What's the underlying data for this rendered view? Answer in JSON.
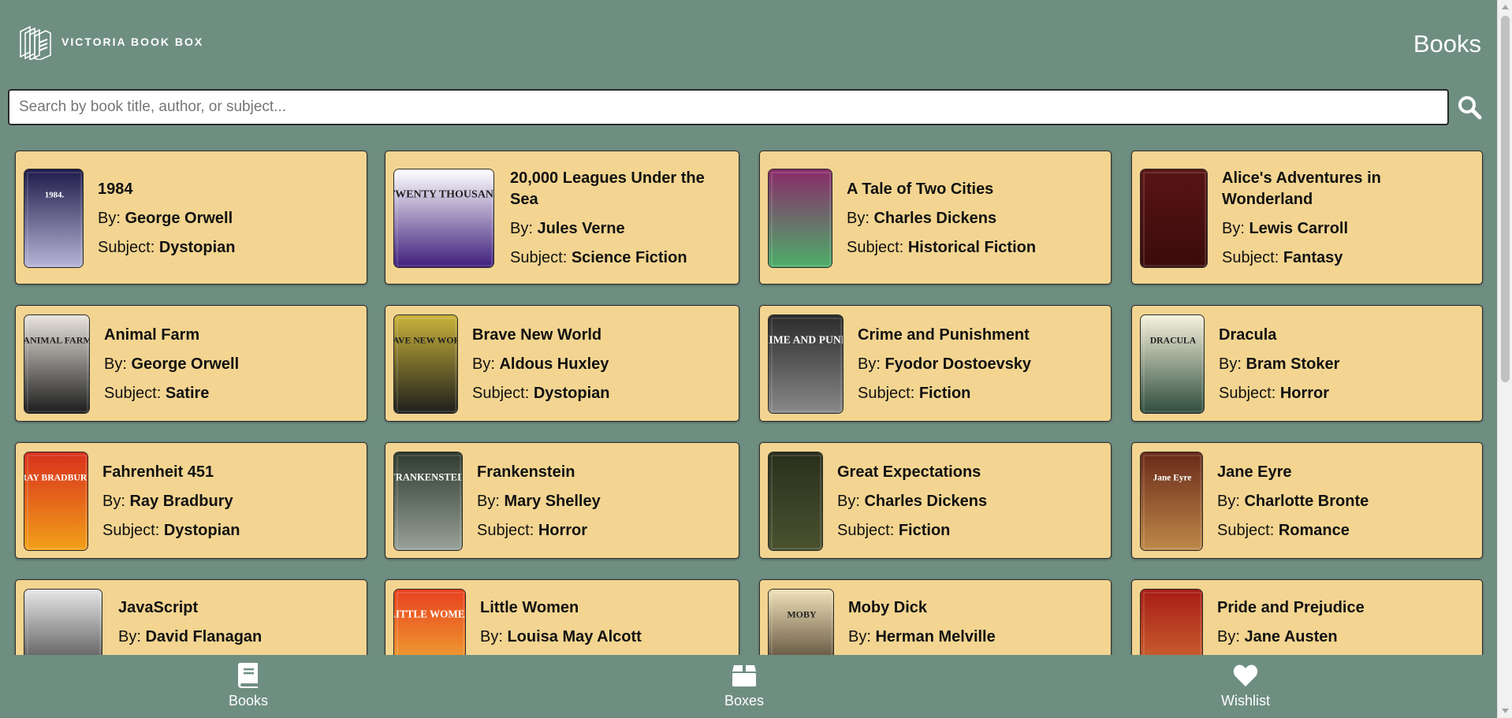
{
  "header": {
    "brand": "VICTORIA BOOK BOX",
    "page_title": "Books"
  },
  "search": {
    "placeholder": "Search by book title, author, or subject...",
    "value": "",
    "icon": "search-icon"
  },
  "labels": {
    "by": "By: ",
    "subject": "Subject: "
  },
  "books": [
    {
      "title": "1984",
      "author": "George Orwell",
      "subject": "Dystopian",
      "cover_colors": [
        "#1f1a4a",
        "#b8b8d8"
      ],
      "cover_text": "1984."
    },
    {
      "title": "20,000 Leagues Under the Sea",
      "author": "Jules Verne",
      "subject": "Science Fiction",
      "cover_colors": [
        "#ffffff",
        "#3b1a7a"
      ],
      "cover_text": "TWENTY THOUSAND LEAGUES UNDER THE SEA"
    },
    {
      "title": "A Tale of Two Cities",
      "author": "Charles Dickens",
      "subject": "Historical Fiction",
      "cover_colors": [
        "#8a2b6a",
        "#4bb06a"
      ],
      "cover_text": ""
    },
    {
      "title": "Alice's Adventures in Wonderland",
      "author": "Lewis Carroll",
      "subject": "Fantasy",
      "cover_colors": [
        "#5a1414",
        "#3a0b0b"
      ],
      "cover_text": ""
    },
    {
      "title": "Animal Farm",
      "author": "George Orwell",
      "subject": "Satire",
      "cover_colors": [
        "#e8e4dc",
        "#1a1a1a"
      ],
      "cover_text": "ANIMAL FARM"
    },
    {
      "title": "Brave New World",
      "author": "Aldous Huxley",
      "subject": "Dystopian",
      "cover_colors": [
        "#c9b23a",
        "#1c1c1c"
      ],
      "cover_text": "BRAVE NEW WORLD"
    },
    {
      "title": "Crime and Punishment",
      "author": "Fyodor Dostoevsky",
      "subject": "Fiction",
      "cover_colors": [
        "#2b2b2b",
        "#8a8a8a"
      ],
      "cover_text": "CRIME AND PUNISHMENT"
    },
    {
      "title": "Dracula",
      "author": "Bram Stoker",
      "subject": "Horror",
      "cover_colors": [
        "#f6f2dc",
        "#2c4a3a"
      ],
      "cover_text": "DRACULA"
    },
    {
      "title": "Fahrenheit 451",
      "author": "Ray Bradbury",
      "subject": "Dystopian",
      "cover_colors": [
        "#d8301c",
        "#f3a21a"
      ],
      "cover_text": "RAY BRADBURY"
    },
    {
      "title": "Frankenstein",
      "author": "Mary Shelley",
      "subject": "Horror",
      "cover_colors": [
        "#2e3b2e",
        "#9aa39a"
      ],
      "cover_text": "FRANKENSTEIN"
    },
    {
      "title": "Great Expectations",
      "author": "Charles Dickens",
      "subject": "Fiction",
      "cover_colors": [
        "#2a2f1c",
        "#4a5230"
      ],
      "cover_text": ""
    },
    {
      "title": "Jane Eyre",
      "author": "Charlotte Bronte",
      "subject": "Romance",
      "cover_colors": [
        "#6a2a1a",
        "#c08a4a"
      ],
      "cover_text": "Jane Eyre"
    },
    {
      "title": "JavaScript",
      "author": "David Flanagan",
      "subject": "",
      "cover_colors": [
        "#e6e6e6",
        "#2a2a2a"
      ],
      "cover_text": ""
    },
    {
      "title": "Little Women",
      "author": "Louisa May Alcott",
      "subject": "",
      "cover_colors": [
        "#e8401e",
        "#f2c23a"
      ],
      "cover_text": "LITTLE WOMEN"
    },
    {
      "title": "Moby Dick",
      "author": "Herman Melville",
      "subject": "",
      "cover_colors": [
        "#f0e2b8",
        "#2a1a10"
      ],
      "cover_text": "MOBY"
    },
    {
      "title": "Pride and Prejudice",
      "author": "Jane Austen",
      "subject": "",
      "cover_colors": [
        "#a81c14",
        "#d47a3a"
      ],
      "cover_text": ""
    }
  ],
  "nav": [
    {
      "label": "Books",
      "icon": "book-icon"
    },
    {
      "label": "Boxes",
      "icon": "box-icon"
    },
    {
      "label": "Wishlist",
      "icon": "heart-icon"
    }
  ],
  "colors": {
    "background": "#6f8e82",
    "card": "#f3d591",
    "card_border": "#2c2c2c",
    "text": "#111111",
    "nav_text": "#ffffff"
  }
}
